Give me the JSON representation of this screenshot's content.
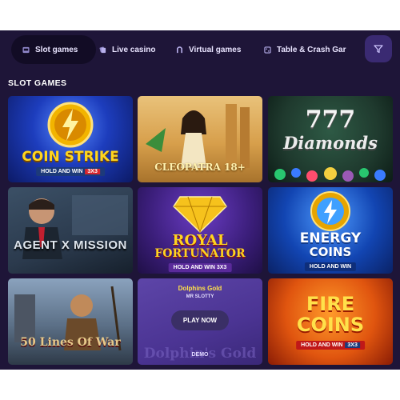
{
  "tabs": [
    {
      "label": "Slot games",
      "icon": "slot-machine-icon",
      "active": true
    },
    {
      "label": "Live casino",
      "icon": "live-casino-icon",
      "active": false
    },
    {
      "label": "Virtual games",
      "icon": "horseshoe-icon",
      "active": false
    },
    {
      "label": "Table & Crash Gar",
      "icon": "dice-icon",
      "active": false
    }
  ],
  "filter": {
    "icon": "filter-icon"
  },
  "section": {
    "title": "SLOT GAMES"
  },
  "games": [
    {
      "title": "COIN STRIKE",
      "badge": "HOLD AND WIN",
      "badge_x": "3X3",
      "bg": "#1d3dbd"
    },
    {
      "title": "CLEOPATRA 18+",
      "bg": "#d79f4b"
    },
    {
      "title": "777",
      "subtitle": "Diamonds",
      "bg": "#1f3a2e"
    },
    {
      "title": "AGENT X MISSION",
      "bg": "#2b3a4d"
    },
    {
      "title": "ROYAL",
      "subtitle": "FORTUNATOR",
      "badge": "HOLD AND WIN 3X3",
      "bg": "#3b1e7a"
    },
    {
      "title": "ENERGY",
      "subtitle": "COINS",
      "badge": "HOLD AND WIN",
      "bg": "#1245b2"
    },
    {
      "title": "50 Lines Of War",
      "bg": "#5b6f86"
    },
    {
      "title": "Dolphins Gold",
      "provider": "MR SLOTTY",
      "play": "PLAY NOW",
      "demo": "DEMO",
      "watermark": "Dolphin's Gold",
      "bg": "#4b3493"
    },
    {
      "title": "FIRE",
      "subtitle": "COINS",
      "badge": "HOLD AND WIN",
      "badge_x": "3X3",
      "bg": "#e0550f"
    }
  ],
  "colors": {
    "background": "#1e1538",
    "tab_active": "#120c25",
    "filter_bg": "#3a2a72",
    "text": "#ffffff"
  }
}
